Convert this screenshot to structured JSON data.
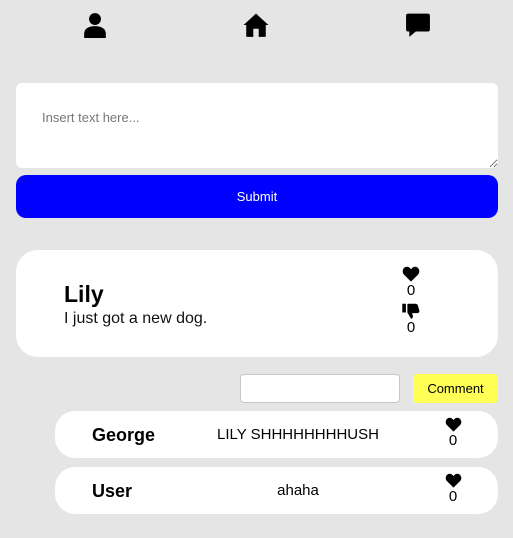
{
  "nav": {
    "items": [
      {
        "name": "profile",
        "icon": "user-icon"
      },
      {
        "name": "home",
        "icon": "home-icon"
      },
      {
        "name": "messages",
        "icon": "comment-icon"
      }
    ]
  },
  "composer": {
    "placeholder": "Insert text here...",
    "submit_label": "Submit"
  },
  "post": {
    "author": "Lily",
    "text": "I just got a new dog.",
    "likes": "0",
    "dislikes": "0",
    "like_icon": "heart-icon",
    "dislike_icon": "thumbs-down-icon"
  },
  "comment_form": {
    "value": "",
    "button_label": "Comment"
  },
  "comments": [
    {
      "author": "George",
      "text": "LILY SHHHHHHHHUSH",
      "likes": "0"
    },
    {
      "author": "User",
      "text": "ahaha",
      "likes": "0"
    }
  ],
  "colors": {
    "background": "#e5e5e5",
    "submit": "#0000ff",
    "comment_button": "#ffff55",
    "card": "#ffffff"
  }
}
